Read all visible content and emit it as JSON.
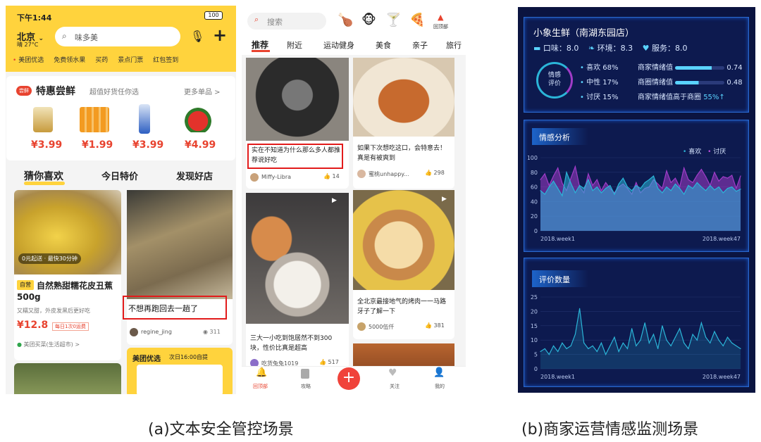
{
  "left_phone": {
    "status": {
      "time": "下午1:44",
      "battery": "100"
    },
    "city": "北京",
    "temp": "晴 27°C",
    "search_placeholder": "味多美",
    "categories": [
      "美团优选",
      "免费领水果",
      "买药",
      "景点门票",
      "红包签到"
    ],
    "deal_section": {
      "badge": "尝鲜",
      "title": "特惠尝鲜",
      "subtitle": "超值好货任你选",
      "more": "更多单品 >"
    },
    "prices": [
      "¥3.99",
      "¥1.99",
      "¥3.99",
      "¥4.99"
    ],
    "tabs": [
      "猜你喜欢",
      "今日特价",
      "发现好店"
    ],
    "item1": {
      "delivery": "0元起送 · 最快30分钟",
      "tag": "自营",
      "title": "自然熟甜糯花皮丑蕉500g",
      "desc": "又糯又甜，外皮发黑后更好吃",
      "price": "¥12.8",
      "promo": "每日1次0运费",
      "store": "美团买菜(生活超市) >"
    },
    "item2": {
      "title": "不想再跑回去一趟了",
      "user": "regine_jing",
      "views": "311"
    },
    "item3": {
      "brand": "美团优选",
      "note": "次日16:00自提"
    }
  },
  "mid_phone": {
    "search_placeholder": "搜索",
    "top_right_label": "回顶部",
    "tabs": [
      "推荐",
      "附近",
      "运动健身",
      "美食",
      "亲子",
      "旅行"
    ],
    "posts": [
      {
        "title": "实在不知道为什么那么多人都推荐说好吃",
        "user": "Miffy-Libra",
        "likes": "14"
      },
      {
        "title": "如果下次想吃这口，会特意去！真是有被爽到",
        "user": "蜜桃unhappy...",
        "likes": "298"
      },
      {
        "title": "三大一小吃到饱居然不到300块，性价比真是超高",
        "user": "吃货兔兔1019",
        "likes": "517"
      },
      {
        "title": "全北京最接地气的烤肉一一马路牙子了解一下",
        "user": "5000伍仟",
        "likes": "381"
      }
    ],
    "bottom_nav": [
      "回顶部",
      "攻略",
      "关注",
      "我的"
    ]
  },
  "dashboard": {
    "store": "小象生鲜（南湖东园店）",
    "scores": [
      {
        "label": "口味：",
        "value": "8.0"
      },
      {
        "label": "环境：",
        "value": "8.3"
      },
      {
        "label": "服务：",
        "value": "8.0"
      }
    ],
    "ring_label": "情感\n评价",
    "sentiments": [
      {
        "label": "喜欢",
        "pct": "68%"
      },
      {
        "label": "中性",
        "pct": "17%"
      },
      {
        "label": "讨厌",
        "pct": "15%"
      }
    ],
    "merchant": [
      {
        "label": "商家情绪值",
        "value": "0.74",
        "fill": 0.74
      },
      {
        "label": "商圈情绪值",
        "value": "0.48",
        "fill": 0.48
      }
    ],
    "compare": {
      "label": "商家情绪值高于商圈",
      "value": "55%↑"
    },
    "sentiment_chart": {
      "title": "情感分析",
      "legend": [
        "喜欢",
        "讨厌"
      ]
    },
    "count_chart": {
      "title": "评价数量"
    }
  },
  "captions": [
    "(a)文本安全管控场景",
    "(b)商家运营情感监测场景"
  ],
  "chart_data": [
    {
      "type": "area",
      "title": "情感分析",
      "x_start": "2018.week1",
      "x_end": "2018.week47",
      "ylim": [
        0,
        100
      ],
      "yticks": [
        0,
        20,
        40,
        60,
        80,
        100
      ],
      "series": [
        {
          "name": "喜欢",
          "color": "#2bb5d8",
          "values": [
            55,
            50,
            60,
            68,
            58,
            48,
            80,
            65,
            52,
            62,
            58,
            70,
            55,
            60,
            52,
            58,
            62,
            50,
            64,
            72,
            60,
            55,
            62,
            58,
            66,
            70,
            75,
            58,
            52,
            60,
            55,
            64,
            58,
            50,
            62,
            58,
            66,
            60,
            55,
            62,
            56,
            60,
            52,
            58,
            60,
            54,
            57
          ]
        },
        {
          "name": "讨厌",
          "color": "#a03cc8",
          "values": [
            70,
            78,
            62,
            75,
            86,
            65,
            55,
            72,
            88,
            60,
            52,
            78,
            62,
            70,
            55,
            66,
            58,
            52,
            60,
            64,
            58,
            50,
            66,
            52,
            58,
            60,
            70,
            64,
            58,
            82,
            66,
            72,
            60,
            86,
            70,
            66,
            76,
            84,
            74,
            62,
            80,
            68,
            74,
            72,
            76,
            58,
            75
          ]
        }
      ]
    },
    {
      "type": "line",
      "title": "评价数量",
      "x_start": "2018.week1",
      "x_end": "2018.week47",
      "ylim": [
        0,
        25
      ],
      "yticks": [
        0,
        5,
        10,
        15,
        20,
        25
      ],
      "series": [
        {
          "name": "",
          "color": "#2bb5d8",
          "values": [
            6,
            7,
            5,
            8,
            6,
            9,
            7,
            8,
            12,
            21,
            9,
            7,
            8,
            6,
            9,
            5,
            8,
            11,
            6,
            9,
            7,
            14,
            8,
            10,
            16,
            9,
            12,
            7,
            15,
            10,
            8,
            11,
            14,
            9,
            7,
            12,
            10,
            16,
            11,
            9,
            13,
            10,
            8,
            11,
            9,
            8,
            7
          ]
        }
      ]
    }
  ]
}
